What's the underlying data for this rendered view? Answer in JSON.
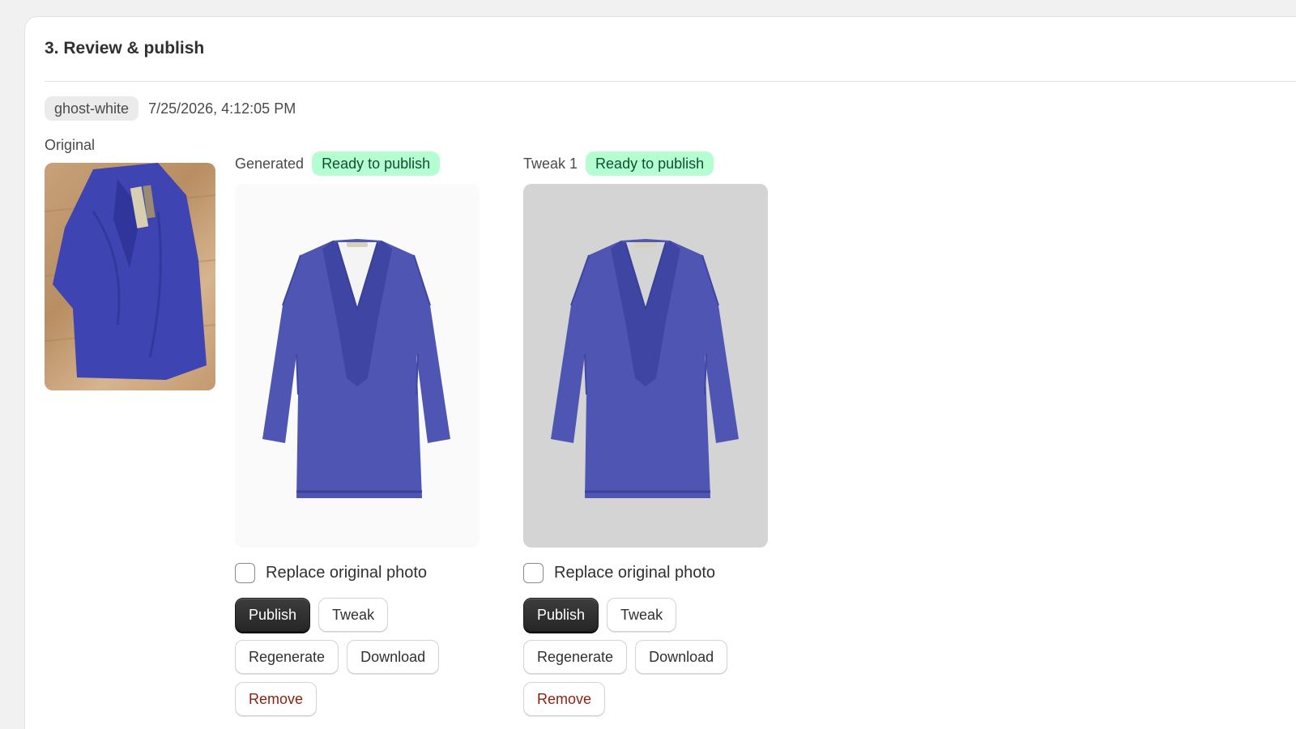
{
  "section": {
    "title": "3. Review & publish"
  },
  "meta": {
    "tag": "ghost-white",
    "timestamp": "7/25/2026, 4:12:05 PM"
  },
  "original": {
    "label": "Original"
  },
  "variants": [
    {
      "label": "Generated",
      "status": "Ready to publish",
      "replace_label": "Replace original photo",
      "replace_checked": false,
      "buttons": {
        "publish": "Publish",
        "tweak": "Tweak",
        "regenerate": "Regenerate",
        "download": "Download",
        "remove": "Remove"
      }
    },
    {
      "label": "Tweak 1",
      "status": "Ready to publish",
      "replace_label": "Replace original photo",
      "replace_checked": false,
      "buttons": {
        "publish": "Publish",
        "tweak": "Tweak",
        "regenerate": "Regenerate",
        "download": "Download",
        "remove": "Remove"
      }
    }
  ],
  "colors": {
    "badge_bg": "#b4fed2",
    "badge_text": "#0c5132",
    "remove_text": "#8e1f0b",
    "garment": "#4f55b3"
  }
}
